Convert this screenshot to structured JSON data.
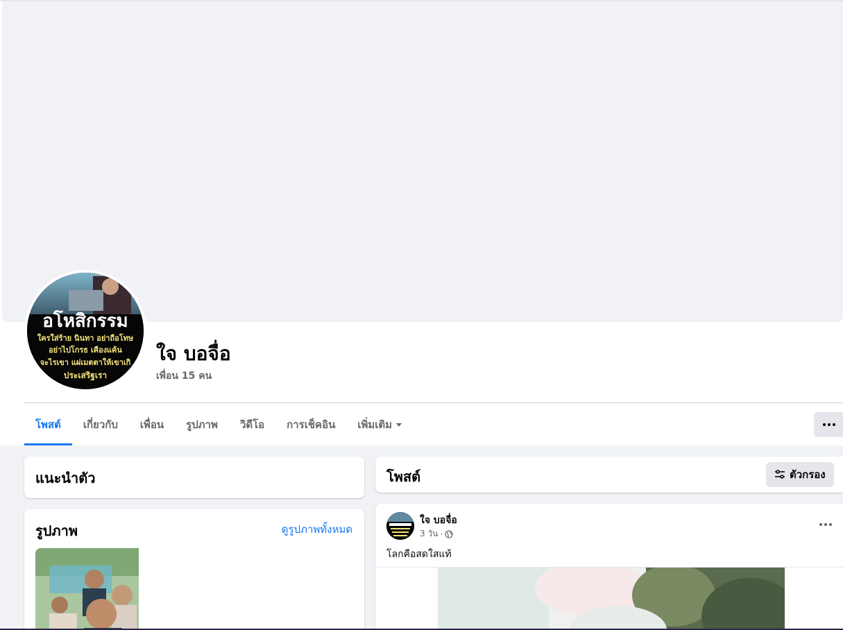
{
  "profile": {
    "name": "ใจ บอจื่อ",
    "friends": "เพื่อน 15 คน",
    "avatar_text": {
      "title": "อโหสิกรรม",
      "lines": [
        "ใครใส่ร้าย นินทา อย่าถือโทษ",
        "อย่าไปโกรธ เคืองแค้น",
        "จะไรเขา แผ่เมตตาให้เขาเกิ",
        "ประเสริฐเรา"
      ]
    }
  },
  "tabs": [
    {
      "label": "โพสต์",
      "active": true
    },
    {
      "label": "เกี่ยวกับ"
    },
    {
      "label": "เพื่อน"
    },
    {
      "label": "รูปภาพ"
    },
    {
      "label": "วิดีโอ"
    },
    {
      "label": "การเช็คอิน"
    },
    {
      "label": "เพิ่มเติม"
    }
  ],
  "intro": {
    "title": "แนะนำตัว"
  },
  "photos": {
    "title": "รูปภาพ",
    "see_all": "ดูรูปภาพทั้งหมด"
  },
  "posts": {
    "title": "โพสต์",
    "filter_label": "ตัวกรอง",
    "items": [
      {
        "author": "ใจ บอจื่อ",
        "time": "3 วัน",
        "separator": "·",
        "privacy_icon": "globe-icon",
        "text": "โลกคือสดใสแท้"
      }
    ]
  },
  "colors": {
    "accent": "#1877f2",
    "secondary_text": "#65676b",
    "background": "#f0f2f5"
  }
}
